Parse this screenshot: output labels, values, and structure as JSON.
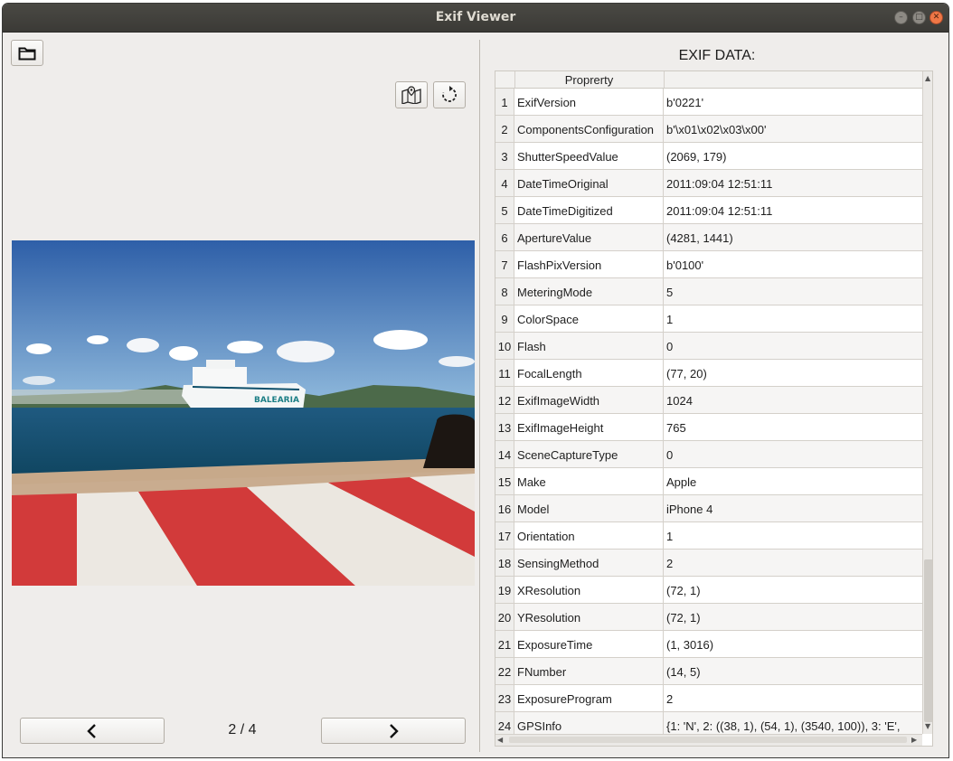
{
  "window": {
    "title": "Exif Viewer"
  },
  "toolbar": {
    "open_icon": "folder-icon",
    "map_icon": "map-pin-icon",
    "rotate_icon": "rotate-icon"
  },
  "exif": {
    "heading": "EXIF DATA:",
    "header": {
      "property": "Proprerty",
      "value": ""
    },
    "rows": [
      {
        "num": "1",
        "property": "ExifVersion",
        "value": "b'0221'"
      },
      {
        "num": "2",
        "property": "ComponentsConfiguration",
        "value": "b'\\x01\\x02\\x03\\x00'"
      },
      {
        "num": "3",
        "property": "ShutterSpeedValue",
        "value": "(2069, 179)"
      },
      {
        "num": "4",
        "property": "DateTimeOriginal",
        "value": "2011:09:04 12:51:11"
      },
      {
        "num": "5",
        "property": "DateTimeDigitized",
        "value": "2011:09:04 12:51:11"
      },
      {
        "num": "6",
        "property": "ApertureValue",
        "value": "(4281, 1441)"
      },
      {
        "num": "7",
        "property": "FlashPixVersion",
        "value": "b'0100'"
      },
      {
        "num": "8",
        "property": "MeteringMode",
        "value": "5"
      },
      {
        "num": "9",
        "property": "ColorSpace",
        "value": "1"
      },
      {
        "num": "10",
        "property": "Flash",
        "value": "0"
      },
      {
        "num": "11",
        "property": "FocalLength",
        "value": "(77, 20)"
      },
      {
        "num": "12",
        "property": "ExifImageWidth",
        "value": "1024"
      },
      {
        "num": "13",
        "property": "ExifImageHeight",
        "value": "765"
      },
      {
        "num": "14",
        "property": "SceneCaptureType",
        "value": "0"
      },
      {
        "num": "15",
        "property": "Make",
        "value": "Apple"
      },
      {
        "num": "16",
        "property": "Model",
        "value": "iPhone 4"
      },
      {
        "num": "17",
        "property": "Orientation",
        "value": "1"
      },
      {
        "num": "18",
        "property": "SensingMethod",
        "value": "2"
      },
      {
        "num": "19",
        "property": "XResolution",
        "value": "(72, 1)"
      },
      {
        "num": "20",
        "property": "YResolution",
        "value": "(72, 1)"
      },
      {
        "num": "21",
        "property": "ExposureTime",
        "value": "(1, 3016)"
      },
      {
        "num": "22",
        "property": "FNumber",
        "value": "(14, 5)"
      },
      {
        "num": "23",
        "property": "ExposureProgram",
        "value": "2"
      },
      {
        "num": "24",
        "property": "GPSInfo",
        "value": "{1: 'N', 2: ((38, 1), (54, 1), (3540, 100)), 3: 'E',"
      }
    ]
  },
  "pager": {
    "text": "2 / 4",
    "prev_icon": "chevron-left-icon",
    "next_icon": "chevron-right-icon"
  },
  "colors": {
    "titlebar": "#3c3b37",
    "window_bg": "#efedeb",
    "close_button": "#f07746"
  }
}
